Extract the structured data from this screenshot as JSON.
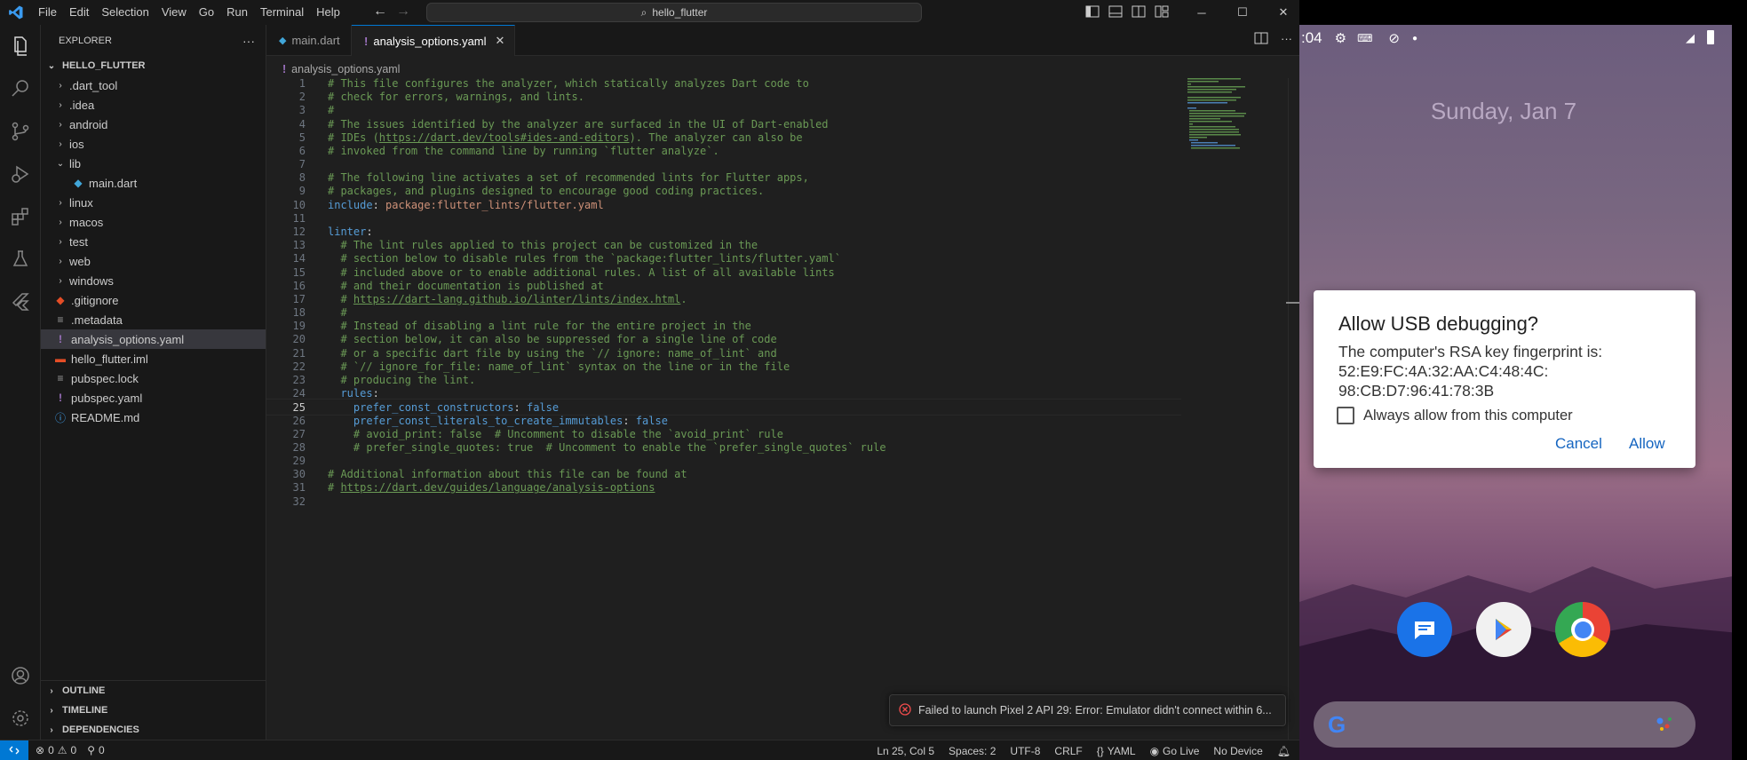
{
  "titlebar": {
    "menu": [
      "File",
      "Edit",
      "Selection",
      "View",
      "Go",
      "Run",
      "Terminal",
      "Help"
    ],
    "search": "hello_flutter"
  },
  "sidebar": {
    "title": "EXPLORER",
    "root": "HELLO_FLUTTER",
    "items": [
      {
        "label": ".dart_tool",
        "type": "folder"
      },
      {
        "label": ".idea",
        "type": "folder"
      },
      {
        "label": "android",
        "type": "folder"
      },
      {
        "label": "ios",
        "type": "folder"
      },
      {
        "label": "lib",
        "type": "folder-open"
      },
      {
        "label": "main.dart",
        "type": "dart"
      },
      {
        "label": "linux",
        "type": "folder"
      },
      {
        "label": "macos",
        "type": "folder"
      },
      {
        "label": "test",
        "type": "folder"
      },
      {
        "label": "web",
        "type": "folder"
      },
      {
        "label": "windows",
        "type": "folder"
      },
      {
        "label": ".gitignore",
        "type": "git"
      },
      {
        "label": ".metadata",
        "type": "meta"
      },
      {
        "label": "analysis_options.yaml",
        "type": "yaml"
      },
      {
        "label": "hello_flutter.iml",
        "type": "iml"
      },
      {
        "label": "pubspec.lock",
        "type": "lock"
      },
      {
        "label": "pubspec.yaml",
        "type": "yaml"
      },
      {
        "label": "README.md",
        "type": "md"
      }
    ],
    "sections": [
      "OUTLINE",
      "TIMELINE",
      "DEPENDENCIES"
    ]
  },
  "tabs": [
    {
      "label": "main.dart",
      "active": false
    },
    {
      "label": "analysis_options.yaml",
      "active": true
    }
  ],
  "breadcrumb": "analysis_options.yaml",
  "editor": {
    "current_line": 25,
    "lines": [
      [
        [
          "c",
          "# This file configures the analyzer, which statically analyzes Dart code to"
        ]
      ],
      [
        [
          "c",
          "# check for errors, warnings, and lints."
        ]
      ],
      [
        [
          "c",
          "#"
        ]
      ],
      [
        [
          "c",
          "# The issues identified by the analyzer are surfaced in the UI of Dart-enabled"
        ]
      ],
      [
        [
          "c",
          "# IDEs ("
        ],
        [
          "l",
          "https://dart.dev/tools#ides-and-editors"
        ],
        [
          "c",
          "). The analyzer can also be"
        ]
      ],
      [
        [
          "c",
          "# invoked from the command line by running `flutter analyze`."
        ]
      ],
      [],
      [
        [
          "c",
          "# The following line activates a set of recommended lints for Flutter apps,"
        ]
      ],
      [
        [
          "c",
          "# packages, and plugins designed to encourage good coding practices."
        ]
      ],
      [
        [
          "k",
          "include"
        ],
        [
          "p",
          ": "
        ],
        [
          "s",
          "package:flutter_lints/flutter.yaml"
        ]
      ],
      [],
      [
        [
          "k",
          "linter"
        ],
        [
          "p",
          ":"
        ]
      ],
      [
        [
          "p",
          "  "
        ],
        [
          "c",
          "# The lint rules applied to this project can be customized in the"
        ]
      ],
      [
        [
          "p",
          "  "
        ],
        [
          "c",
          "# section below to disable rules from the `package:flutter_lints/flutter.yaml`"
        ]
      ],
      [
        [
          "p",
          "  "
        ],
        [
          "c",
          "# included above or to enable additional rules. A list of all available lints"
        ]
      ],
      [
        [
          "p",
          "  "
        ],
        [
          "c",
          "# and their documentation is published at"
        ]
      ],
      [
        [
          "p",
          "  "
        ],
        [
          "c",
          "# "
        ],
        [
          "l",
          "https://dart-lang.github.io/linter/lints/index.html"
        ],
        [
          "c",
          "."
        ]
      ],
      [
        [
          "p",
          "  "
        ],
        [
          "c",
          "#"
        ]
      ],
      [
        [
          "p",
          "  "
        ],
        [
          "c",
          "# Instead of disabling a lint rule for the entire project in the"
        ]
      ],
      [
        [
          "p",
          "  "
        ],
        [
          "c",
          "# section below, it can also be suppressed for a single line of code"
        ]
      ],
      [
        [
          "p",
          "  "
        ],
        [
          "c",
          "# or a specific dart file by using the `// ignore: name_of_lint` and"
        ]
      ],
      [
        [
          "p",
          "  "
        ],
        [
          "c",
          "# `// ignore_for_file: name_of_lint` syntax on the line or in the file"
        ]
      ],
      [
        [
          "p",
          "  "
        ],
        [
          "c",
          "# producing the lint."
        ]
      ],
      [
        [
          "p",
          "  "
        ],
        [
          "k",
          "rules"
        ],
        [
          "p",
          ":"
        ]
      ],
      [
        [
          "p",
          "    "
        ],
        [
          "k",
          "prefer_const_constructors"
        ],
        [
          "p",
          ": "
        ],
        [
          "k",
          "false"
        ]
      ],
      [
        [
          "p",
          "    "
        ],
        [
          "k",
          "prefer_const_literals_to_create_immutables"
        ],
        [
          "p",
          ": "
        ],
        [
          "k",
          "false"
        ]
      ],
      [
        [
          "p",
          "    "
        ],
        [
          "c",
          "# avoid_print: false  # Uncomment to disable the `avoid_print` rule"
        ]
      ],
      [
        [
          "p",
          "    "
        ],
        [
          "c",
          "# prefer_single_quotes: true  # Uncomment to enable the `prefer_single_quotes` rule"
        ]
      ],
      [],
      [
        [
          "c",
          "# Additional information about this file can be found at"
        ]
      ],
      [
        [
          "c",
          "# "
        ],
        [
          "l",
          "https://dart.dev/guides/language/analysis-options"
        ]
      ],
      []
    ]
  },
  "notification": "Failed to launch Pixel 2 API 29: Error: Emulator didn't connect within 6...",
  "statusbar": {
    "errors": "0",
    "warnings": "0",
    "ports": "0",
    "position": "Ln 25, Col 5",
    "spaces": "Spaces: 2",
    "encoding": "UTF-8",
    "eol": "CRLF",
    "language": "YAML",
    "golive": "Go Live",
    "device": "No Device"
  },
  "phone": {
    "time": ":04",
    "date": "Sunday, Jan 7",
    "dialog": {
      "title": "Allow USB debugging?",
      "body": "The computer's RSA key fingerprint is: 52:E9:FC:4A:32:AA:C4:48:4C: 98:CB:D7:96:41:78:3B",
      "checkbox": "Always allow from this computer",
      "cancel": "Cancel",
      "allow": "Allow"
    }
  }
}
